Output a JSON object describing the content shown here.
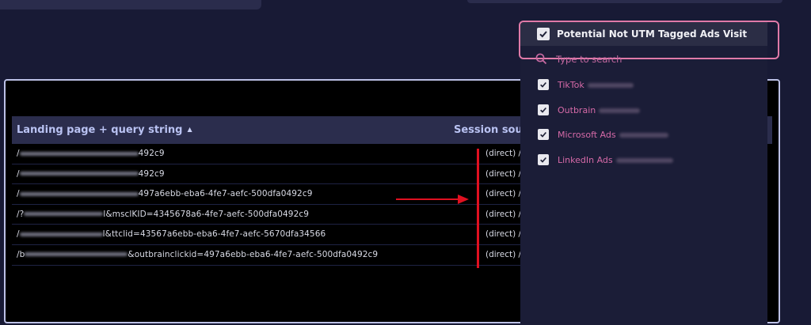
{
  "report": {
    "columns": {
      "landing": "Landing page + query string",
      "session": "Session sourc"
    },
    "rows": [
      {
        "landing_prefix": "/",
        "landing_suffix": "492c9",
        "session": "(direct) /"
      },
      {
        "landing_prefix": "/",
        "landing_suffix": "492c9",
        "session": "(direct) /"
      },
      {
        "landing_prefix": "/",
        "landing_suffix": "497a6ebb-eba6-4fe7-aefc-500dfa0492c9",
        "session": "(direct) /"
      },
      {
        "landing_prefix": "/?",
        "landing_suffix": "l&msclKID=4345678a6-4fe7-aefc-500dfa0492c9",
        "session": "(direct) /"
      },
      {
        "landing_prefix": "/",
        "landing_suffix": "l&ttclid=43567a6ebb-eba6-4fe7-aefc-5670dfa34566",
        "session": "(direct) /"
      },
      {
        "landing_prefix": "/b",
        "landing_suffix": "&outbrainclickid=497a6ebb-eba6-4fe7-aefc-500dfa0492c9",
        "session": "(direct) /"
      }
    ]
  },
  "dropdown": {
    "header_label": "Potential Not UTM Tagged Ads Visit",
    "search_placeholder": "Type to search",
    "options": [
      {
        "label": "TikTok",
        "checked": true
      },
      {
        "label": "Outbrain",
        "checked": true
      },
      {
        "label": "Microsoft Ads",
        "checked": true
      },
      {
        "label": "LinkedIn Ads",
        "checked": true
      }
    ]
  },
  "colors": {
    "annotation_red": "#e01020",
    "dropdown_border": "#e07aa8",
    "option_text": "#d66aa8"
  },
  "icons": {
    "checkbox": "check-icon",
    "search": "search-icon",
    "sort": "sort-asc-icon",
    "arrow": "red-arrow-icon"
  }
}
